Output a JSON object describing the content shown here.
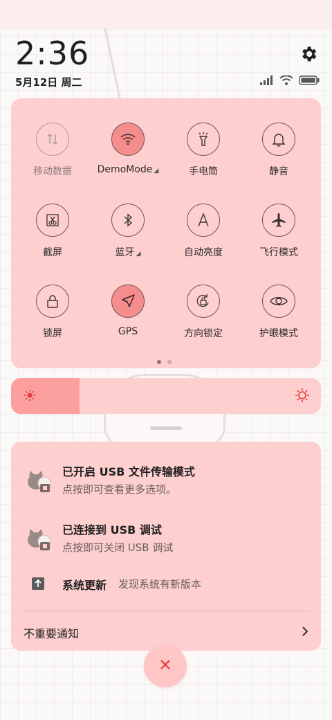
{
  "status": {
    "time": "2:36",
    "date": "5月12日 周二"
  },
  "tiles": [
    {
      "id": "mobile-data",
      "label": "移动数据",
      "state": "disabled",
      "icon": "arrows-updown-icon"
    },
    {
      "id": "wifi",
      "label": "DemoMode",
      "state": "active",
      "icon": "wifi-icon",
      "expand": true
    },
    {
      "id": "flashlight",
      "label": "手电筒",
      "state": "off",
      "icon": "flashlight-icon"
    },
    {
      "id": "mute",
      "label": "静音",
      "state": "off",
      "icon": "bell-icon"
    },
    {
      "id": "screenshot",
      "label": "截屏",
      "state": "off",
      "icon": "scissors-icon"
    },
    {
      "id": "bluetooth",
      "label": "蓝牙",
      "state": "off",
      "icon": "bluetooth-icon",
      "expand": true
    },
    {
      "id": "auto-brightness",
      "label": "自动亮度",
      "state": "off",
      "icon": "auto-brightness-icon"
    },
    {
      "id": "airplane",
      "label": "飞行模式",
      "state": "off",
      "icon": "airplane-icon"
    },
    {
      "id": "lock-screen",
      "label": "锁屏",
      "state": "off",
      "icon": "lock-icon"
    },
    {
      "id": "gps",
      "label": "GPS",
      "state": "active",
      "icon": "location-arrow-icon"
    },
    {
      "id": "rotation-lock",
      "label": "方向锁定",
      "state": "off",
      "icon": "rotation-lock-icon"
    },
    {
      "id": "eye-care",
      "label": "护眼模式",
      "state": "off",
      "icon": "eye-icon"
    }
  ],
  "pages": {
    "count": 2,
    "current": 1
  },
  "brightness": {
    "level": 0.22
  },
  "notifications": [
    {
      "title": "已开启 USB 文件传输模式",
      "subtitle": "点按即可查看更多选项。"
    },
    {
      "title": "已连接到 USB 调试",
      "subtitle": "点按即可关闭 USB 调试"
    }
  ],
  "system_update": {
    "title": "系统更新",
    "desc": "发现系统有新版本"
  },
  "unimportant": {
    "label": "不重要通知"
  },
  "colors": {
    "panel": "#fecfcf",
    "active": "#f58d8d",
    "accent": "#e53935"
  }
}
